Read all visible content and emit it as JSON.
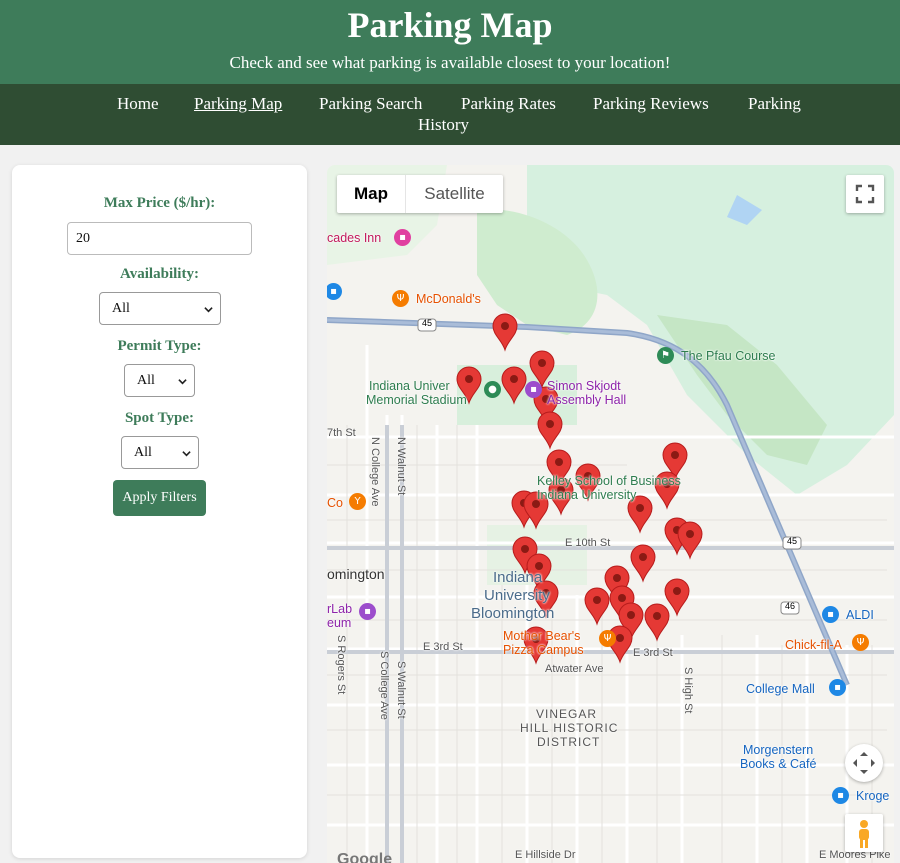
{
  "header": {
    "title": "Parking Map",
    "subtitle": "Check and see what parking is available closest to your location!"
  },
  "nav": [
    {
      "label": "Home",
      "active": false
    },
    {
      "label": "Parking Map",
      "active": true
    },
    {
      "label": "Parking Search",
      "active": false
    },
    {
      "label": "Parking Rates",
      "active": false
    },
    {
      "label": "Parking Reviews",
      "active": false
    },
    {
      "label": "Parking",
      "active": false
    },
    {
      "label": "History",
      "active": false
    }
  ],
  "filters": {
    "max_price_label": "Max Price ($/hr):",
    "max_price_value": "20",
    "availability_label": "Availability:",
    "availability_value": "All",
    "permit_label": "Permit Type:",
    "permit_value": "All",
    "spot_label": "Spot Type:",
    "spot_value": "All",
    "apply_label": "Apply Filters"
  },
  "map": {
    "toggle": {
      "map": "Map",
      "satellite": "Satellite"
    },
    "labels": {
      "cascades_inn": "cades Inn",
      "mcdonalds": "McDonald's",
      "pfau": "The Pfau Course",
      "stadium_1": "Indiana Univer",
      "stadium_2": "Memorial Stadium",
      "assembly_1": "Simon Skjodt",
      "assembly_2": "Assembly Hall",
      "seventh": "7th St",
      "kelley_1": "Kelley School of Business",
      "kelley_2": "Indiana University",
      "co": "Co",
      "e10th": "E 10th St",
      "bloomington_city": "omington",
      "iu_1": "Indiana",
      "iu_2": "University",
      "iu_3": "Bloomington",
      "lab_1": "rLab",
      "lab_2": "eum",
      "mother_bears_1": "Mother Bear's",
      "mother_bears_2": "Pizza Campus",
      "e3rd_w": "E 3rd St",
      "e3rd_e": "E 3rd St",
      "atwater": "Atwater Ave",
      "vinegar_1": "VINEGAR",
      "vinegar_2": "HILL HISTORIC",
      "vinegar_3": "DISTRICT",
      "aldi": "ALDI",
      "chickfila": "Chick-fil-A",
      "college_mall": "College Mall",
      "morgenstern_1": "Morgenstern",
      "morgenstern_2": "Books & Café",
      "kroger": "Kroge",
      "college_ave": "N College Ave",
      "walnut": "N Walnut St",
      "s_rogers": "S Rogers St",
      "s_college": "S College Ave",
      "s_walnut": "S Walnut St",
      "s_high": "S High St",
      "hillside": "E Hillside Dr",
      "moores": "E Moores Pike",
      "r45a": "45",
      "r45b": "45",
      "r46": "46",
      "google": "Google"
    },
    "colors": {
      "pin": "#e53935",
      "pin_dot": "#8b1a14",
      "park": "#c9ecd6",
      "road": "#ffffff",
      "highway": "#8fa6c8"
    }
  }
}
